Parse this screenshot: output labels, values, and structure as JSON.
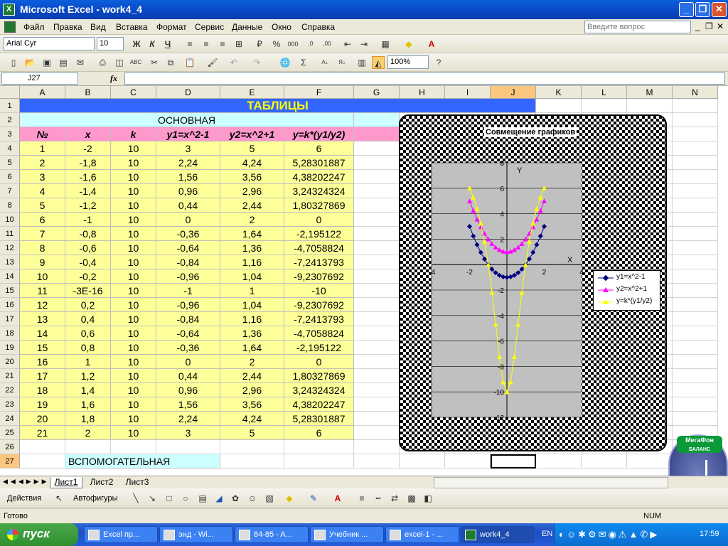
{
  "window": {
    "title": "Microsoft Excel - work4_4",
    "app_icon": "X"
  },
  "menu": [
    "Файл",
    "Правка",
    "Вид",
    "Вставка",
    "Формат",
    "Сервис",
    "Данные",
    "Окно",
    "Справка"
  ],
  "help_box": {
    "placeholder": "Введите вопрос"
  },
  "format_bar": {
    "font": "Arial Cyr",
    "size": "10",
    "bold": "Ж",
    "italic": "К",
    "underline": "Ч"
  },
  "standard_bar": {
    "zoom": "100%"
  },
  "name_box": "J27",
  "fx": "fx",
  "columns": [
    "A",
    "B",
    "C",
    "D",
    "E",
    "F",
    "G",
    "H",
    "I",
    "J",
    "K",
    "L",
    "M",
    "N"
  ],
  "row_numbers": [
    "1",
    "2",
    "3",
    "4",
    "5",
    "6",
    "7",
    "8",
    "10",
    "11",
    "12",
    "13",
    "14",
    "15",
    "16",
    "17",
    "18",
    "19",
    "20",
    "21",
    "22",
    "23",
    "24",
    "25",
    "26",
    "27"
  ],
  "sheet": {
    "title": "ТАБЛИЦЫ",
    "subtitle": "ОСНОВНАЯ",
    "aux_label": "ВСПОМОГАТЕЛЬНАЯ",
    "headers": [
      "№",
      "x",
      "k",
      "y1=x^2-1",
      "y2=x^2+1",
      "y=k*(y1/y2)"
    ],
    "rows": [
      [
        "1",
        "-2",
        "10",
        "3",
        "5",
        "6"
      ],
      [
        "2",
        "-1,8",
        "10",
        "2,24",
        "4,24",
        "5,28301887"
      ],
      [
        "3",
        "-1,6",
        "10",
        "1,56",
        "3,56",
        "4,38202247"
      ],
      [
        "4",
        "-1,4",
        "10",
        "0,96",
        "2,96",
        "3,24324324"
      ],
      [
        "5",
        "-1,2",
        "10",
        "0,44",
        "2,44",
        "1,80327869"
      ],
      [
        "6",
        "-1",
        "10",
        "0",
        "2",
        "0"
      ],
      [
        "7",
        "-0,8",
        "10",
        "-0,36",
        "1,64",
        "-2,195122"
      ],
      [
        "8",
        "-0,6",
        "10",
        "-0,64",
        "1,36",
        "-4,7058824"
      ],
      [
        "9",
        "-0,4",
        "10",
        "-0,84",
        "1,16",
        "-7,2413793"
      ],
      [
        "10",
        "-0,2",
        "10",
        "-0,96",
        "1,04",
        "-9,2307692"
      ],
      [
        "11",
        "-3E-16",
        "10",
        "-1",
        "1",
        "-10"
      ],
      [
        "12",
        "0,2",
        "10",
        "-0,96",
        "1,04",
        "-9,2307692"
      ],
      [
        "13",
        "0,4",
        "10",
        "-0,84",
        "1,16",
        "-7,2413793"
      ],
      [
        "14",
        "0,6",
        "10",
        "-0,64",
        "1,36",
        "-4,7058824"
      ],
      [
        "15",
        "0,8",
        "10",
        "-0,36",
        "1,64",
        "-2,195122"
      ],
      [
        "16",
        "1",
        "10",
        "0",
        "2",
        "0"
      ],
      [
        "17",
        "1,2",
        "10",
        "0,44",
        "2,44",
        "1,80327869"
      ],
      [
        "18",
        "1,4",
        "10",
        "0,96",
        "2,96",
        "3,24324324"
      ],
      [
        "19",
        "1,6",
        "10",
        "1,56",
        "3,56",
        "4,38202247"
      ],
      [
        "20",
        "1,8",
        "10",
        "2,24",
        "4,24",
        "5,28301887"
      ],
      [
        "21",
        "2",
        "10",
        "3",
        "5",
        "6"
      ]
    ]
  },
  "colors": {
    "title_bg": "#3366ff",
    "title_fg": "#ffff00",
    "subtitle_bg": "#ccffff",
    "header_bg": "#ff99cc",
    "data_bg": "#ffff99",
    "plot_bg": "#c0c0c0",
    "s1": "#000080",
    "s2": "#ff00ff",
    "s3": "#ffff00"
  },
  "chart_data": {
    "type": "line",
    "title": "Совмещение графиков",
    "xlabel": "X",
    "ylabel": "Y",
    "xlim": [
      -4,
      4
    ],
    "ylim": [
      -12,
      8
    ],
    "x_ticks": [
      "-4",
      "-2",
      "2",
      "4"
    ],
    "y_ticks": [
      "8",
      "6",
      "4",
      "2",
      "-2",
      "-4",
      "-6",
      "-8",
      "-10",
      "-12"
    ],
    "legend_position": "right",
    "x": [
      -2,
      -1.8,
      -1.6,
      -1.4,
      -1.2,
      -1,
      -0.8,
      -0.6,
      -0.4,
      -0.2,
      0,
      0.2,
      0.4,
      0.6,
      0.8,
      1,
      1.2,
      1.4,
      1.6,
      1.8,
      2
    ],
    "series": [
      {
        "name": "y1=x^2-1",
        "values": [
          3,
          2.24,
          1.56,
          0.96,
          0.44,
          0,
          -0.36,
          -0.64,
          -0.84,
          -0.96,
          -1,
          -0.96,
          -0.84,
          -0.64,
          -0.36,
          0,
          0.44,
          0.96,
          1.56,
          2.24,
          3
        ]
      },
      {
        "name": "y2=x^2+1",
        "values": [
          5,
          4.24,
          3.56,
          2.96,
          2.44,
          2,
          1.64,
          1.36,
          1.16,
          1.04,
          1,
          1.04,
          1.16,
          1.36,
          1.64,
          2,
          2.44,
          2.96,
          3.56,
          4.24,
          5
        ]
      },
      {
        "name": "y=k*(y1/y2)",
        "values": [
          6,
          5.283,
          4.382,
          3.243,
          1.803,
          0,
          -2.195,
          -4.706,
          -7.241,
          -9.231,
          -10,
          -9.231,
          -7.241,
          -4.706,
          -2.195,
          0,
          1.803,
          3.243,
          4.382,
          5.283,
          6
        ]
      }
    ]
  },
  "sheet_tabs": [
    "Лист1",
    "Лист2",
    "Лист3"
  ],
  "drawing_bar": {
    "actions": "Действия",
    "autoshapes": "Автофигуры"
  },
  "status": {
    "left": "Готово",
    "right": "NUM"
  },
  "widget": {
    "label": "МегаФон",
    "sub": "БАЛАНС"
  },
  "taskbar": {
    "start": "пуск",
    "tasks": [
      "Excel  пр...",
      "энд - Wi...",
      "84-85 - A...",
      "Учебник ...",
      "excel-1 - ...",
      "work4_4"
    ],
    "lang": "EN",
    "clock": "17:59"
  }
}
